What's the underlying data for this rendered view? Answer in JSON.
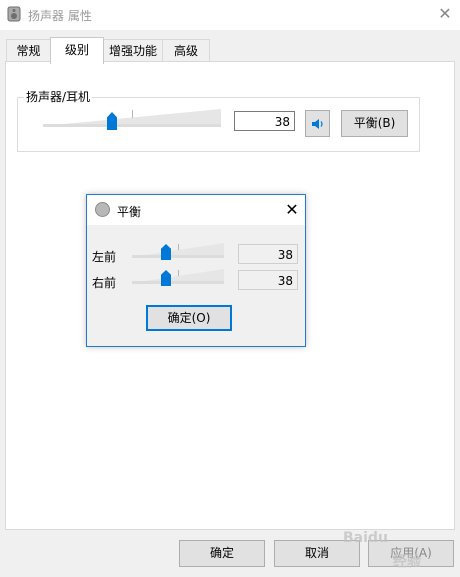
{
  "window": {
    "title": "扬声器 属性",
    "close_glyph": "✕"
  },
  "tabs": [
    {
      "label": "常规"
    },
    {
      "label": "级别"
    },
    {
      "label": "增强功能"
    },
    {
      "label": "高级"
    }
  ],
  "levels": {
    "group_label": "扬声器/耳机",
    "volume_value": "38",
    "volume_level_percent": 38,
    "mute_icon": "speaker-icon",
    "balance_button": "平衡(B)"
  },
  "balance_dialog": {
    "title": "平衡",
    "close_glyph": "✕",
    "left_label": "左前",
    "left_value": "38",
    "left_level_percent": 38,
    "right_label": "右前",
    "right_value": "38",
    "right_level_percent": 38,
    "ok_button": "确定(O)"
  },
  "footer": {
    "ok_button": "确定",
    "cancel_button": "取消",
    "apply_button": "应用(A)"
  },
  "watermark": {
    "line1": "Baidu",
    "line2": "经验"
  },
  "colors": {
    "accent": "#0078d7",
    "dialog_border": "#1f7ad0"
  }
}
